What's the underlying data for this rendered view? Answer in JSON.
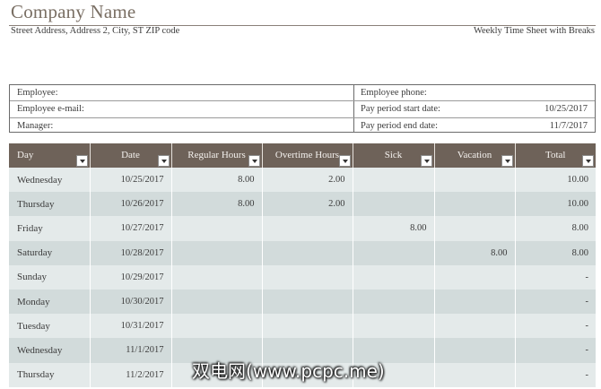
{
  "header": {
    "company": "Company Name",
    "address": "Street Address, Address 2, City, ST ZIP code",
    "subtitle": "Weekly Time Sheet with Breaks"
  },
  "info": {
    "left": [
      {
        "label": "Employee:"
      },
      {
        "label": "Employee e-mail:"
      },
      {
        "label": "Manager:"
      }
    ],
    "right": [
      {
        "label": "Employee phone:",
        "value": ""
      },
      {
        "label": "Pay period start date:",
        "value": "10/25/2017"
      },
      {
        "label": "Pay period end date:",
        "value": "11/7/2017"
      }
    ]
  },
  "table": {
    "headers": [
      "Day",
      "Date",
      "Regular Hours",
      "Overtime Hours",
      "Sick",
      "Vacation",
      "Total"
    ],
    "rows": [
      [
        "Wednesday",
        "10/25/2017",
        "8.00",
        "2.00",
        "",
        "",
        "10.00"
      ],
      [
        "Thursday",
        "10/26/2017",
        "8.00",
        "2.00",
        "",
        "",
        "10.00"
      ],
      [
        "Friday",
        "10/27/2017",
        "",
        "",
        "8.00",
        "",
        "8.00"
      ],
      [
        "Saturday",
        "10/28/2017",
        "",
        "",
        "",
        "8.00",
        "8.00"
      ],
      [
        "Sunday",
        "10/29/2017",
        "",
        "",
        "",
        "",
        "-"
      ],
      [
        "Monday",
        "10/30/2017",
        "",
        "",
        "",
        "",
        "-"
      ],
      [
        "Tuesday",
        "10/31/2017",
        "",
        "",
        "",
        "",
        "-"
      ],
      [
        "Wednesday",
        "11/1/2017",
        "",
        "",
        "",
        "",
        "-"
      ],
      [
        "Thursday",
        "11/2/2017",
        "",
        "",
        "",
        "",
        "-"
      ]
    ]
  },
  "watermark": "双电网(www.pcpc.me)",
  "colors": {
    "header_bg": "#6e6259",
    "row_light": "#e4eaea",
    "row_dark": "#d2dbdb",
    "title": "#7a6f64"
  }
}
